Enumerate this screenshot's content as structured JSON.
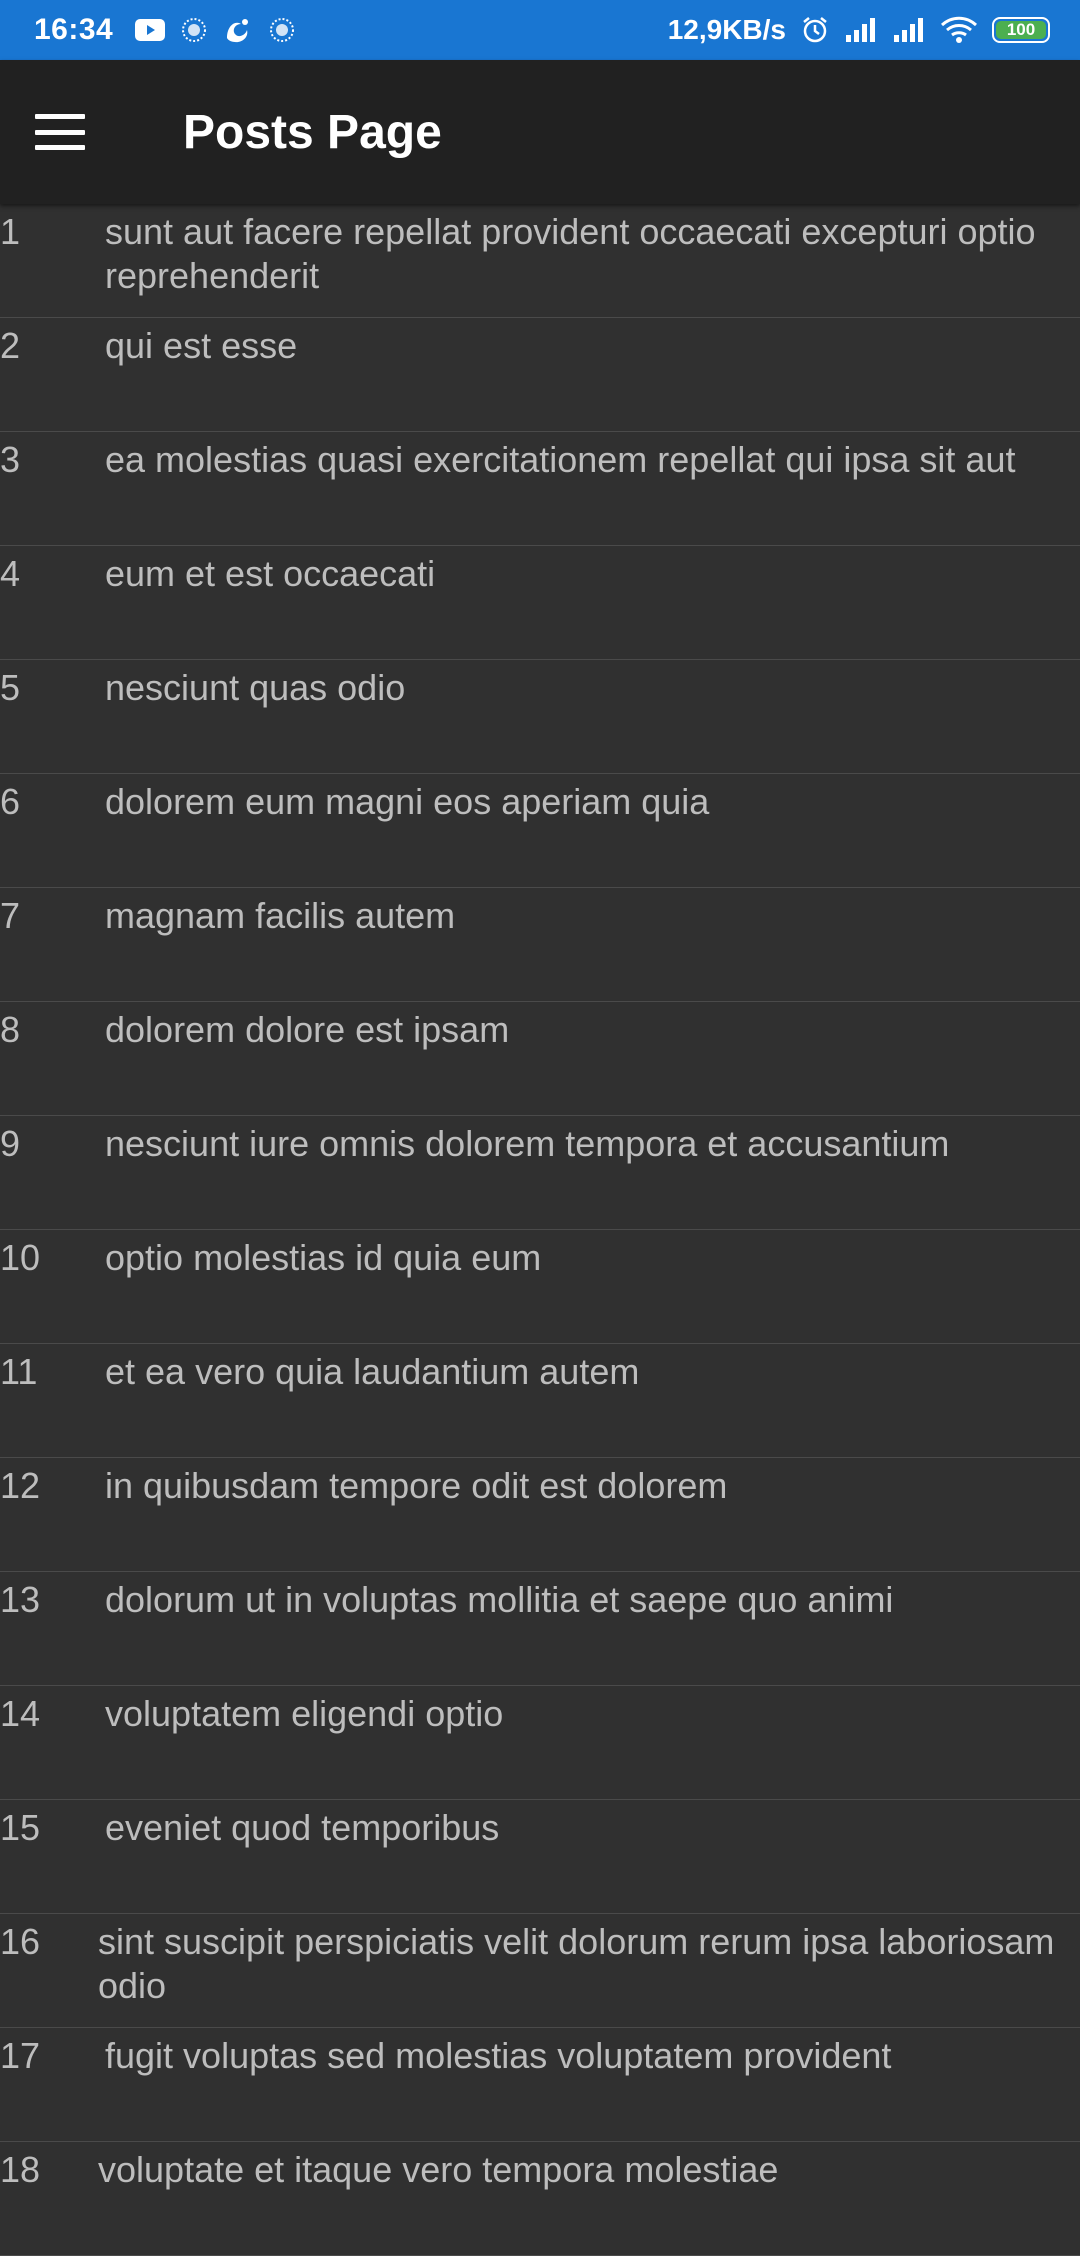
{
  "status_bar": {
    "time": "16:34",
    "network_speed": "12,9KB/s",
    "battery_level": "100",
    "colors": {
      "background": "#1976d2",
      "battery": "#4caf50"
    },
    "icons": [
      "youtube-icon",
      "app-notification-icon",
      "uc-browser-icon",
      "app-notification-icon",
      "alarm-icon",
      "signal-icon",
      "signal-icon",
      "wifi-icon",
      "battery-icon"
    ]
  },
  "app_bar": {
    "title": "Posts Page",
    "menu_icon": "hamburger-menu-icon",
    "colors": {
      "background": "#212121",
      "text": "#ffffff"
    }
  },
  "posts": [
    {
      "id": "1",
      "title": "sunt aut facere repellat provident occaecati excepturi optio reprehenderit"
    },
    {
      "id": "2",
      "title": "qui est esse"
    },
    {
      "id": "3",
      "title": "ea molestias quasi exercitationem repellat qui ipsa sit aut"
    },
    {
      "id": "4",
      "title": "eum et est occaecati"
    },
    {
      "id": "5",
      "title": "nesciunt quas odio"
    },
    {
      "id": "6",
      "title": "dolorem eum magni eos aperiam quia"
    },
    {
      "id": "7",
      "title": "magnam facilis autem"
    },
    {
      "id": "8",
      "title": "dolorem dolore est ipsam"
    },
    {
      "id": "9",
      "title": "nesciunt iure omnis dolorem tempora et accusantium"
    },
    {
      "id": "10",
      "title": "optio molestias id quia eum"
    },
    {
      "id": "11",
      "title": "et ea vero quia laudantium autem"
    },
    {
      "id": "12",
      "title": "in quibusdam tempore odit est dolorem"
    },
    {
      "id": "13",
      "title": "dolorum ut in voluptas mollitia et saepe quo animi"
    },
    {
      "id": "14",
      "title": "voluptatem eligendi optio"
    },
    {
      "id": "15",
      "title": "eveniet quod temporibus"
    },
    {
      "id": "16",
      "title": "sint suscipit perspiciatis velit dolorum rerum ipsa laboriosam odio"
    },
    {
      "id": "17",
      "title": "fugit voluptas sed molestias voluptatem provident"
    },
    {
      "id": "18",
      "title": "voluptate et itaque vero tempora molestiae"
    }
  ],
  "colors": {
    "list_background": "#303030",
    "list_text": "#bdbdbd",
    "divider": "#4a4a4a"
  }
}
